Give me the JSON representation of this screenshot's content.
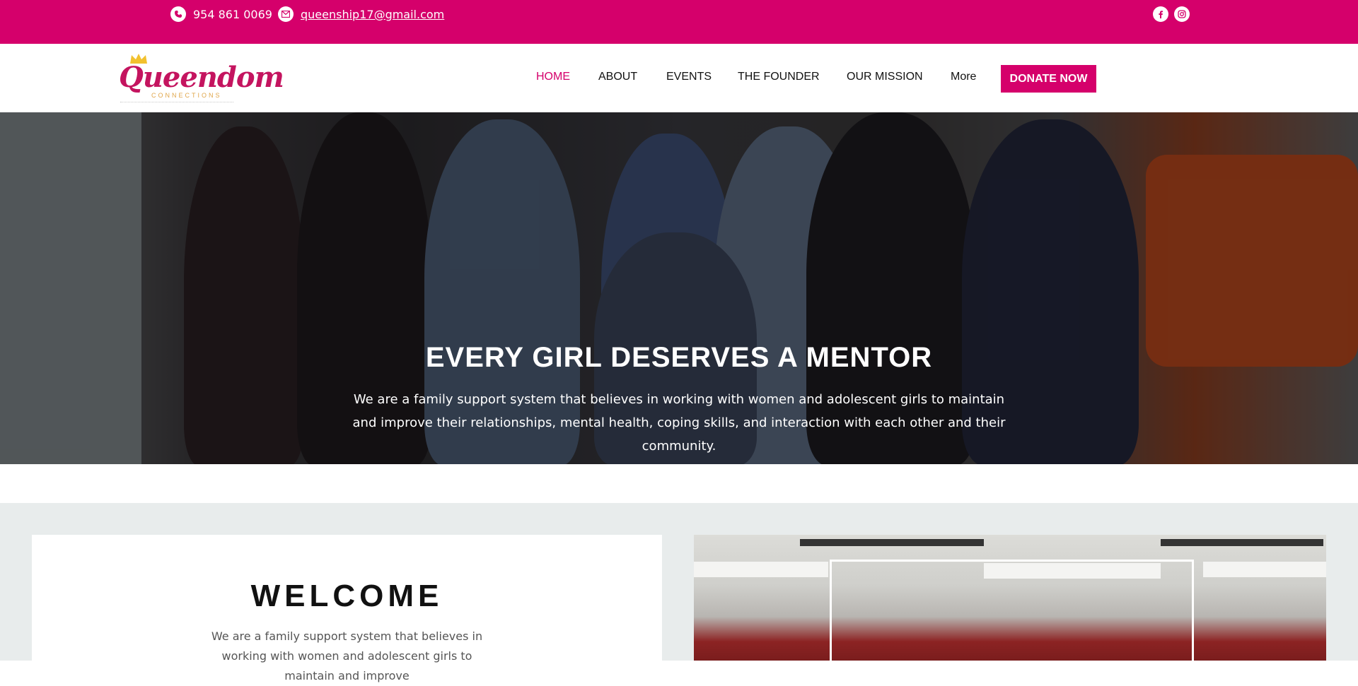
{
  "topbar": {
    "phone": "954 861 0069",
    "email": "queenship17@gmail.com",
    "social": [
      {
        "icon": "facebook-icon"
      },
      {
        "icon": "instagram-icon"
      }
    ],
    "bg_color": "#d5006b"
  },
  "header": {
    "logo_text": "Queendom",
    "logo_sub": "CONNECTIONS",
    "nav": [
      "HOME",
      "ABOUT",
      "EVENTS",
      "THE FOUNDER",
      "OUR MISSION",
      "More"
    ],
    "active_nav": "HOME",
    "donate_label": "DONATE NOW",
    "accent_color": "#d5006b"
  },
  "hero": {
    "title": "EVERY GIRL DESERVES A MENTOR",
    "subtitle": "We are a family support system that believes in working with women and adolescent girls to maintain and improve their relationships, mental health, coping skills, and interaction with each other and their community."
  },
  "welcome": {
    "title": "WELCOME",
    "body": "We are a family support system that believes in working with women and adolescent girls to maintain and improve"
  }
}
